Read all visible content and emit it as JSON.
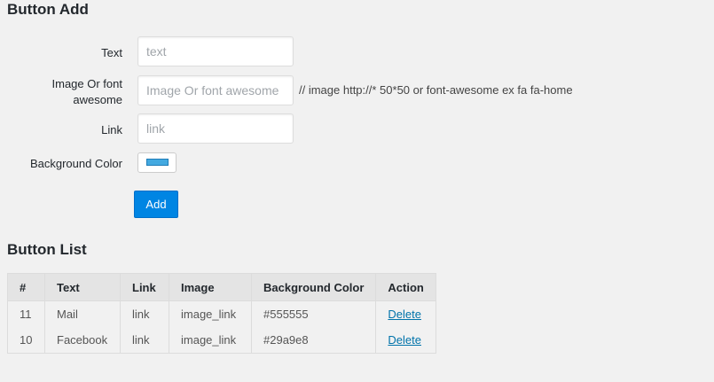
{
  "add_section": {
    "title": "Button Add",
    "fields": {
      "text": {
        "label": "Text",
        "placeholder": "text",
        "value": ""
      },
      "image": {
        "label": "Image Or font awesome",
        "placeholder": "Image Or font awesome",
        "value": "",
        "hint": "// image http://* 50*50 or font-awesome ex fa fa-home"
      },
      "link": {
        "label": "Link",
        "placeholder": "link",
        "value": ""
      },
      "background_color": {
        "label": "Background Color",
        "value": "#43a9e0"
      }
    },
    "add_label": "Add"
  },
  "list_section": {
    "title": "Button List",
    "columns": [
      "#",
      "Text",
      "Link",
      "Image",
      "Background Color",
      "Action"
    ],
    "rows": [
      {
        "id": "11",
        "text": "Mail",
        "link": "link",
        "image": "image_link",
        "bg_color": "#555555",
        "action": "Delete"
      },
      {
        "id": "10",
        "text": "Facebook",
        "link": "link",
        "image": "image_link",
        "bg_color": "#29a9e8",
        "action": "Delete"
      }
    ]
  }
}
